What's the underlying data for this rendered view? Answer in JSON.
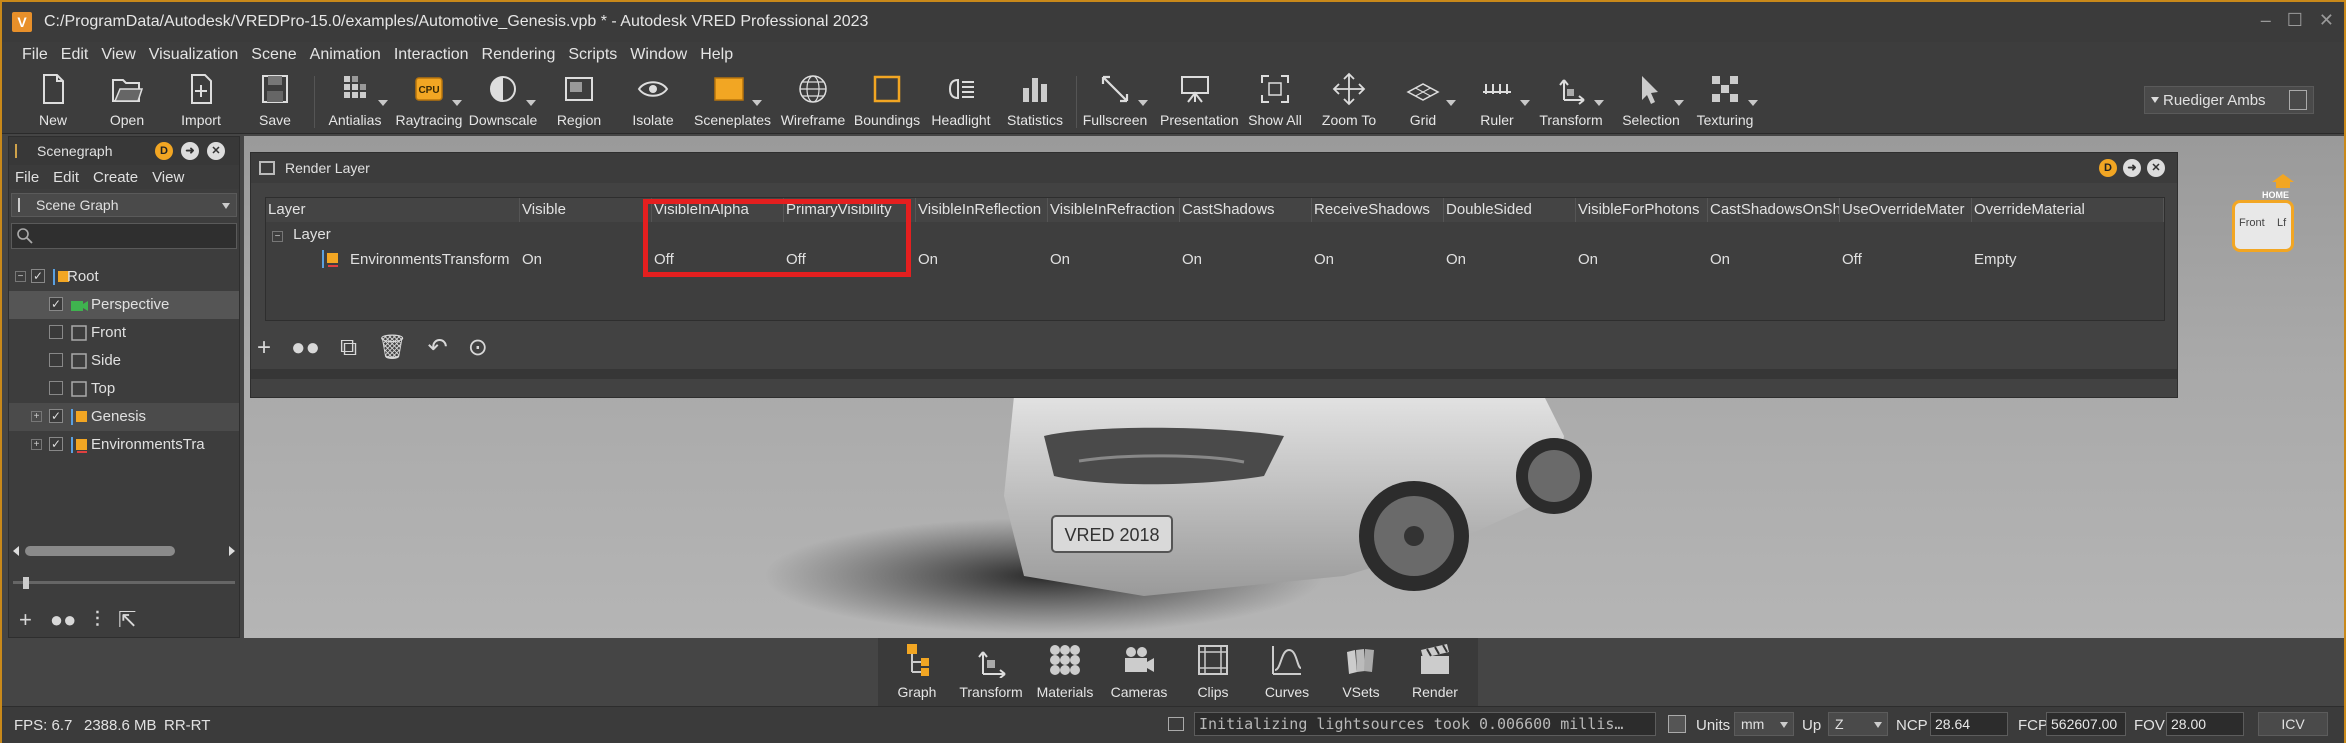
{
  "window": {
    "app_icon": "V",
    "title": "C:/ProgramData/Autodesk/VREDPro-15.0/examples/Automotive_Genesis.vpb * - Autodesk VRED Professional 2023"
  },
  "menu": [
    "File",
    "Edit",
    "View",
    "Visualization",
    "Scene",
    "Animation",
    "Interaction",
    "Rendering",
    "Scripts",
    "Window",
    "Help"
  ],
  "toolbar": [
    {
      "label": "New",
      "icon": "new-file-icon"
    },
    {
      "label": "Open",
      "icon": "folder-open-icon"
    },
    {
      "label": "Import",
      "icon": "import-icon"
    },
    {
      "label": "Save",
      "icon": "save-icon"
    },
    {
      "label": "Antialias",
      "icon": "antialias-icon"
    },
    {
      "label": "Raytracing",
      "icon": "cpu-icon",
      "badge": "CPU"
    },
    {
      "label": "Downscale",
      "icon": "downscale-icon"
    },
    {
      "label": "Region",
      "icon": "region-icon"
    },
    {
      "label": "Isolate",
      "icon": "eye-icon"
    },
    {
      "label": "Sceneplates",
      "icon": "sceneplates-icon"
    },
    {
      "label": "Wireframe",
      "icon": "wireframe-globe-icon"
    },
    {
      "label": "Boundings",
      "icon": "boundings-icon"
    },
    {
      "label": "Headlight",
      "icon": "headlight-icon"
    },
    {
      "label": "Statistics",
      "icon": "statistics-icon"
    },
    {
      "label": "Fullscreen",
      "icon": "fullscreen-icon"
    },
    {
      "label": "Presentation",
      "icon": "presentation-icon"
    },
    {
      "label": "Show All",
      "icon": "show-all-icon"
    },
    {
      "label": "Zoom To",
      "icon": "zoom-to-icon"
    },
    {
      "label": "Grid",
      "icon": "grid-icon"
    },
    {
      "label": "Ruler",
      "icon": "ruler-icon"
    },
    {
      "label": "Transform",
      "icon": "transform-icon"
    },
    {
      "label": "Selection",
      "icon": "selection-icon"
    },
    {
      "label": "Texturing",
      "icon": "texturing-icon"
    }
  ],
  "user": {
    "name": "Ruediger Ambs"
  },
  "scenegraph": {
    "title": "Scenegraph",
    "menu": [
      "File",
      "Edit",
      "Create",
      "View"
    ],
    "mode": "Scene Graph",
    "search_placeholder": "",
    "nodes": [
      {
        "name": "Root",
        "checked": true
      },
      {
        "name": "Perspective",
        "checked": true
      },
      {
        "name": "Front",
        "checked": false
      },
      {
        "name": "Side",
        "checked": false
      },
      {
        "name": "Top",
        "checked": false
      },
      {
        "name": "Genesis",
        "checked": true
      },
      {
        "name": "EnvironmentsTra",
        "checked": true
      }
    ]
  },
  "render_layer": {
    "title": "Render Layer",
    "columns": [
      "Layer",
      "Visible",
      "VisibleInAlpha",
      "PrimaryVisibility",
      "VisibleInReflection",
      "VisibleInRefraction",
      "CastShadows",
      "ReceiveShadows",
      "DoubleSided",
      "VisibleForPhotons",
      "CastShadowsOnSh",
      "UseOverrideMater",
      "OverrideMaterial"
    ],
    "group": "Layer",
    "row": {
      "name": "EnvironmentsTransform",
      "values": [
        "On",
        "Off",
        "Off",
        "On",
        "On",
        "On",
        "On",
        "On",
        "On",
        "On",
        "Off",
        "Empty"
      ]
    }
  },
  "navcube": {
    "home": "HOME",
    "face_front": "Front",
    "face_left": "Lf"
  },
  "plate": "VRED 2018",
  "dock": [
    {
      "label": "Graph",
      "icon": "graph-icon"
    },
    {
      "label": "Transform",
      "icon": "transform-icon"
    },
    {
      "label": "Materials",
      "icon": "materials-icon"
    },
    {
      "label": "Cameras",
      "icon": "cameras-icon"
    },
    {
      "label": "Clips",
      "icon": "clips-icon"
    },
    {
      "label": "Curves",
      "icon": "curves-icon"
    },
    {
      "label": "VSets",
      "icon": "vsets-icon"
    },
    {
      "label": "Render",
      "icon": "clapperboard-icon"
    }
  ],
  "status": {
    "fps": "FPS:  6.7",
    "memory": "2388.6 MB",
    "mode": "RR-RT",
    "log": "Initializing lightsources took 0.006600 millis…",
    "units_label": "Units",
    "units": "mm",
    "up_label": "Up",
    "up": "Z",
    "ncp_label": "NCP",
    "ncp": "28.64",
    "fcp_label": "FCP",
    "fcp": "562607.00",
    "fov_label": "FOV",
    "fov": "28.00",
    "icv": "ICV"
  },
  "colors": {
    "accent": "#e8902a",
    "highlight": "#e41f1f",
    "frame": "#c9891a"
  }
}
